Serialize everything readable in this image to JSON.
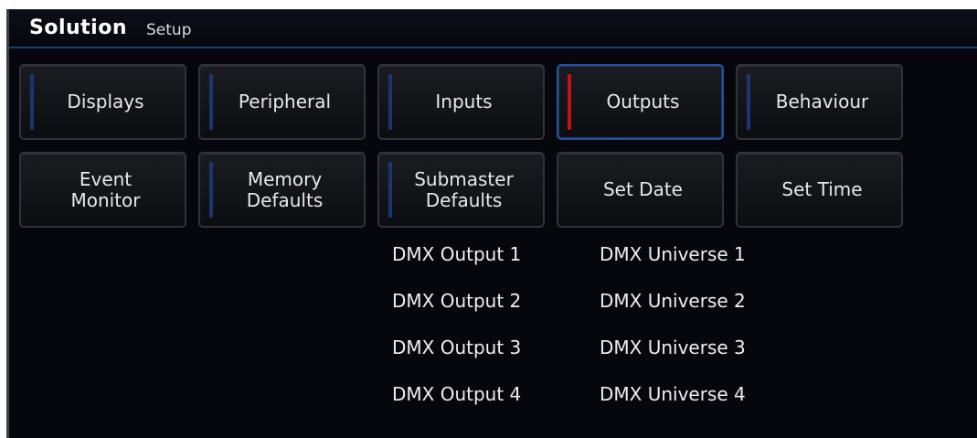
{
  "title": {
    "brand": "Solution",
    "section": "Setup"
  },
  "tabs_row1": [
    {
      "label": "Displays"
    },
    {
      "label": "Peripheral"
    },
    {
      "label": "Inputs"
    },
    {
      "label": "Outputs"
    },
    {
      "label": "Behaviour"
    }
  ],
  "tabs_row2": [
    {
      "label": "Event\nMonitor"
    },
    {
      "label": "Memory\nDefaults"
    },
    {
      "label": "Submaster\nDefaults"
    },
    {
      "label": "Set Date"
    },
    {
      "label": "Set Time"
    }
  ],
  "outputs": [
    {
      "output": "DMX Output 1",
      "universe": "DMX Universe 1"
    },
    {
      "output": "DMX Output 2",
      "universe": "DMX Universe 2"
    },
    {
      "output": "DMX Output 3",
      "universe": "DMX Universe 3"
    },
    {
      "output": "DMX Output 4",
      "universe": "DMX Universe 4"
    }
  ],
  "colors": {
    "background": "#05070c",
    "accent_blue": "#1a3570",
    "active_red": "#c3111a"
  }
}
